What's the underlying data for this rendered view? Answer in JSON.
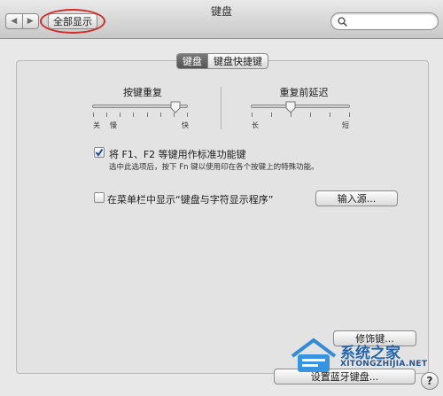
{
  "window": {
    "title": "键盘"
  },
  "toolbar": {
    "back_glyph": "◀",
    "forward_glyph": "▶",
    "show_all_label": "全部显示",
    "search_placeholder": "",
    "icons": [
      "chevron-left-icon",
      "chevron-right-icon",
      "search-icon"
    ]
  },
  "tabs": [
    {
      "label": "键盘",
      "active": true
    },
    {
      "label": "键盘快捷键",
      "active": false
    }
  ],
  "key_repeat": {
    "label": "按键重复",
    "min_label": "关",
    "mid_label": "慢",
    "max_label": "快",
    "value": 0.88
  },
  "delay_until_repeat": {
    "label": "重复前延迟",
    "min_label": "长",
    "max_label": "短",
    "value": 0.4
  },
  "fn_keys": {
    "checked": true,
    "label": "将 F1、F2 等键用作标准功能键",
    "description": "选中此选项后，按下 Fn 键以使用印在各个按键上的特殊功能。"
  },
  "menu_bar_viewer": {
    "checked": false,
    "label": "在菜单栏中显示“键盘与字符显示程序”",
    "input_sources_button": "输入源..."
  },
  "buttons": {
    "modifier_keys": "修饰键...",
    "bluetooth_keyboard": "设置蓝牙键盘..."
  },
  "help": {
    "glyph": "?"
  },
  "watermark": {
    "main": "系统之家",
    "sub": "XITONGZHIJIA.NET"
  },
  "colors": {
    "annotation_circle": "#d42a2a",
    "watermark": "#1d5fa8"
  }
}
